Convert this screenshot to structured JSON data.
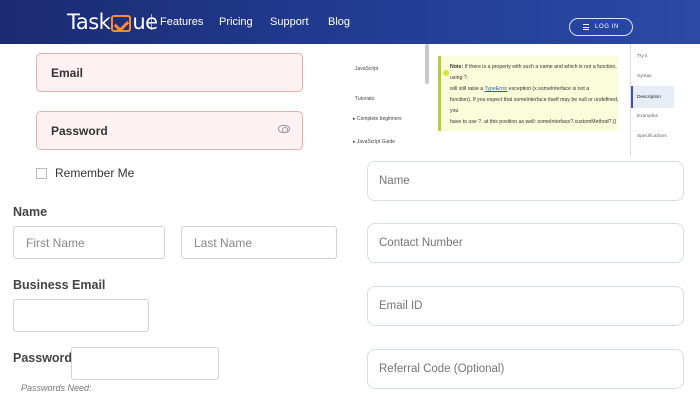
{
  "nav": {
    "logo_pre": "Task",
    "logo_post": "ue",
    "links": [
      "Features",
      "Pricing",
      "Support",
      "Blog"
    ],
    "login_label": "LOG IN"
  },
  "login": {
    "email_placeholder": "Email",
    "password_placeholder": "Password",
    "remember_label": "Remember Me"
  },
  "signup": {
    "name_label": "Name",
    "first_name_placeholder": "First Name",
    "last_name_placeholder": "Last Name",
    "business_email_label": "Business Email",
    "password_label": "Password",
    "password_hint": "Passwords Need:"
  },
  "docs": {
    "sidebar": [
      "JavaScript",
      "Tutorials:",
      "▸ Complete beginners",
      "▸ JavaScript Guide"
    ],
    "note_label": "Note:",
    "note_lines": [
      "If there is a property with such a name and which is not a function, using ?.",
      "will still raise a",
      "exception (x.someInterface is not a",
      "function). If you expect that someInterface itself may be null or undefined, you",
      "have to use ?. at this position as well: someInterface?.customMethod?.()"
    ],
    "note_keyword": "TypeError",
    "toc": [
      "Try it",
      "Syntax",
      "Description",
      "Examples",
      "Specifications"
    ]
  },
  "contact": {
    "name_placeholder": "Name",
    "phone_placeholder": "Contact Number",
    "email_placeholder": "Email ID",
    "referral_placeholder": "Referral Code (Optional)"
  },
  "colors": {
    "nav_bg": "#1b2a72",
    "accent": "#ff8c2a",
    "field_tint": "#fdf2f1"
  }
}
